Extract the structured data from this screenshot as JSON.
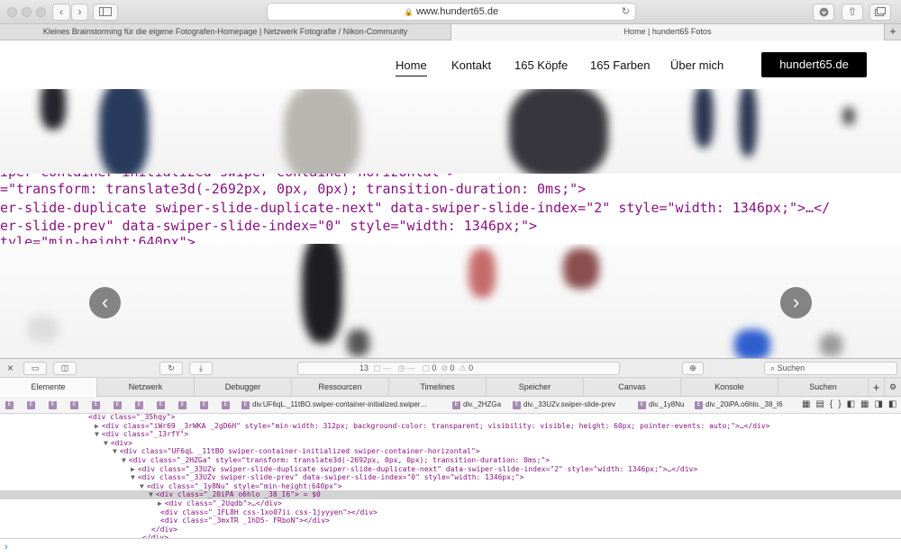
{
  "browser": {
    "url": "www.hundert65.de",
    "back": "‹",
    "forward": "›",
    "tabs": [
      "Kleines Brainstorming für die eigene Fotografen-Homepage | Netzwerk Fotografie / Nikon-Community",
      "Home | hundert65 Fotos"
    ],
    "new_tab": "+"
  },
  "site": {
    "nav": [
      "Home",
      "Kontakt",
      "165 Köpfe",
      "165 Farben",
      "Über mich"
    ],
    "cta": "hundert65.de",
    "prev": "‹",
    "next": "›",
    "overlay": [
      "iper-container initialized swiper-container-horizontal\">",
      "=\"transform: translate3d(-2692px, 0px, 0px); transition-duration: 0ms;\">",
      "er-slide-duplicate swiper-slide-duplicate-next\" data-swiper-slide-index=\"2\" style=\"width: 1346px;\">…</",
      "er-slide-prev\" data-swiper-slide-index=\"0\" style=\"width: 1346px;\">",
      "tyle=\"min-height:640px\">"
    ]
  },
  "devtools": {
    "resource_count": "13",
    "counts": [
      "0",
      "0",
      "0"
    ],
    "search_placeholder": "Suchen",
    "tabs": [
      "Elemente",
      "Netzwerk",
      "Debugger",
      "Ressourcen",
      "Timelines",
      "Speicher",
      "Canvas",
      "Konsole",
      "Suchen"
    ],
    "breadcrumbs": [
      "div.UF6qL._11tBO.swiper-container-initialized.swiper…",
      "div._2HZGa",
      "div._33UZv.swiper-slide-prev",
      "div._1y8Nu",
      "div._20iPA.o6hlo._38_I6"
    ],
    "dom": [
      {
        "indent": 0,
        "tri": "",
        "text": "<div class=\"_35hqy\">"
      },
      {
        "indent": 1,
        "tri": "▶",
        "text": "<div class=\"iWr69 _3rWKA _2gD6H\" style=\"min-width: 312px; background-color: transparent; visibility: visible; height: 60px; pointer-events: auto;\">…</div>"
      },
      {
        "indent": 1,
        "tri": "▼",
        "text": "<div class=\"_13rfY\">"
      },
      {
        "indent": 2,
        "tri": "▼",
        "text": "<div>"
      },
      {
        "indent": 3,
        "tri": "▼",
        "text": "<div class=\"UF6qL _11tBO swiper-container-initialized swiper-container-horizontal\">"
      },
      {
        "indent": 4,
        "tri": "▼",
        "text": "<div class=\"_2HZGa\" style=\"transform: translate3d(-2692px, 0px, 0px); transition-duration: 0ms;\">"
      },
      {
        "indent": 5,
        "tri": "▶",
        "text": "<div class=\"_33UZv swiper-slide-duplicate swiper-slide-duplicate-next\" data-swiper-slide-index=\"2\" style=\"width: 1346px;\">…</div>"
      },
      {
        "indent": 5,
        "tri": "▼",
        "text": "<div class=\"_33UZv swiper-slide-prev\" data-swiper-slide-index=\"0\" style=\"width: 1346px;\">"
      },
      {
        "indent": 6,
        "tri": "▼",
        "text": "<div class=\"_1y8Nu\" style=\"min-height:640px\">"
      },
      {
        "indent": 7,
        "tri": "▼",
        "text": "<div class=\"_20iPA o6hlo _38_I6\"> = $0"
      },
      {
        "indent": 8,
        "tri": "▶",
        "text": "<div class=\"_2Uqdb\">…</div>"
      },
      {
        "indent": 8,
        "tri": "",
        "text": "<div class=\"_1FL8H css-1xo07ii css-1jyyyen\"></div>"
      },
      {
        "indent": 8,
        "tri": "",
        "text": "<div class=\"_3mxTR _1hD5- FRboN\"></div>"
      },
      {
        "indent": 7,
        "tri": "",
        "text": "</div>"
      },
      {
        "indent": 6,
        "tri": "",
        "text": "</div>"
      }
    ],
    "console_prompt": "›"
  },
  "icons": [
    "sidebar-icon",
    "reload-icon",
    "download-icon",
    "share-icon",
    "tabs-icon",
    "close-icon",
    "inspect-icon",
    "search-icon",
    "gear-icon"
  ]
}
